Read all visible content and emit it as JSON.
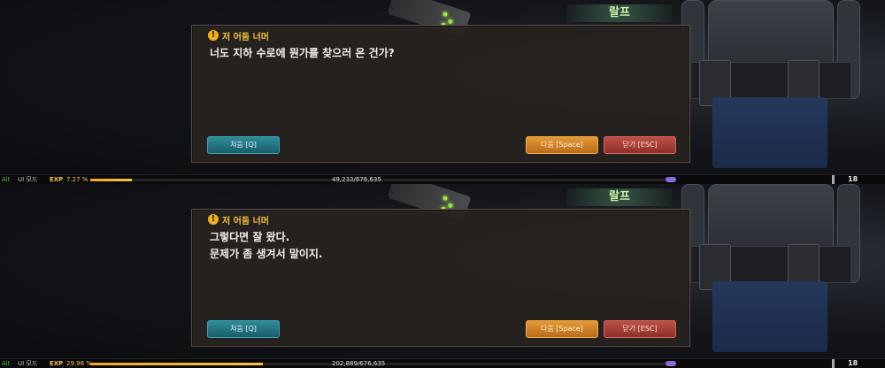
{
  "panels": [
    {
      "npc_name": "랄프",
      "dialog_title": "저 어둠 너머",
      "lines": [
        "너도 지하 수로에 뭔가를 찾으러 온 건가?",
        ""
      ],
      "buttons": {
        "first": "처음 [Q]",
        "next": "다음 [Space]",
        "close": "닫기 [ESC]"
      },
      "status": {
        "alt": "Alt",
        "ui_mode": "UI 모드",
        "exp_label": "EXP",
        "exp_percent": "7.27 %",
        "exp_fraction": 0.0727,
        "exp_numbers": "49,233/676,635",
        "level": "18"
      }
    },
    {
      "npc_name": "랄프",
      "dialog_title": "저 어둠 너머",
      "lines": [
        "그렇다면 잘 왔다.",
        "문제가 좀 생겨서 말이지."
      ],
      "buttons": {
        "first": "처음 [Q]",
        "next": "다음 [Space]",
        "close": "닫기 [ESC]"
      },
      "status": {
        "alt": "Alt",
        "ui_mode": "UI 모드",
        "exp_label": "EXP",
        "exp_percent": "29.98 %",
        "exp_fraction": 0.2998,
        "exp_numbers": "202,889/676,635",
        "level": "18"
      }
    }
  ],
  "icons": {
    "warning": "exclamation-circle-icon"
  },
  "colors": {
    "title": "#f2c23a",
    "first_btn": "#1f6f7a",
    "next_btn": "#d98a2b",
    "close_btn": "#a8443b",
    "exp_bar": "#f0a825"
  }
}
